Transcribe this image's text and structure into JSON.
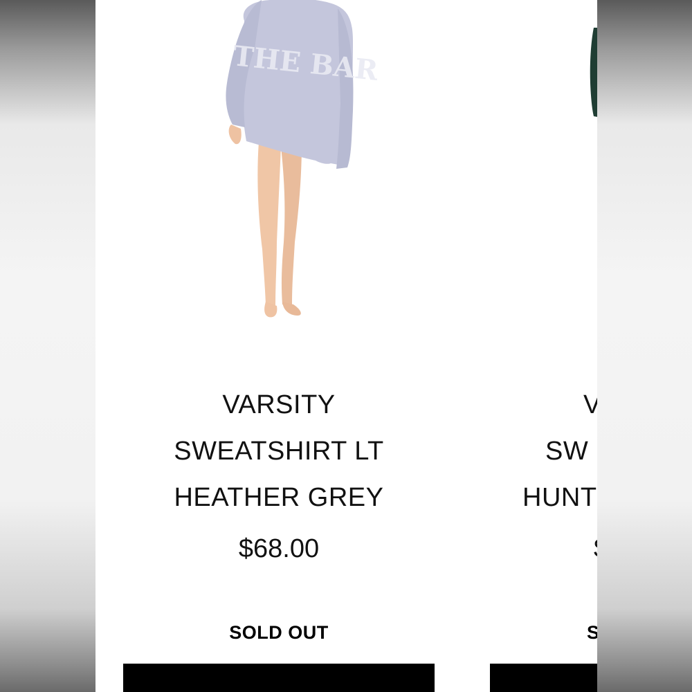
{
  "products": [
    {
      "title_lines": [
        "VARSITY",
        "SWEATSHIRT LT",
        "HEATHER GREY"
      ],
      "price": "$68.00",
      "status": "SOLD OUT",
      "image": {
        "icon": "model-in-grey-sweatshirt-photo",
        "sweatshirt_color": "#c4c6dc",
        "print_text": "THE BAR"
      }
    },
    {
      "title_lines": [
        "V",
        "SW",
        "HUNT"
      ],
      "price": "$",
      "status": "S",
      "image": {
        "icon": "green-sweatshirt-photo-partial",
        "sweatshirt_color": "#1f3d33"
      }
    }
  ],
  "colors": {
    "text": "#111111",
    "button": "#000000",
    "background": "#ffffff"
  }
}
